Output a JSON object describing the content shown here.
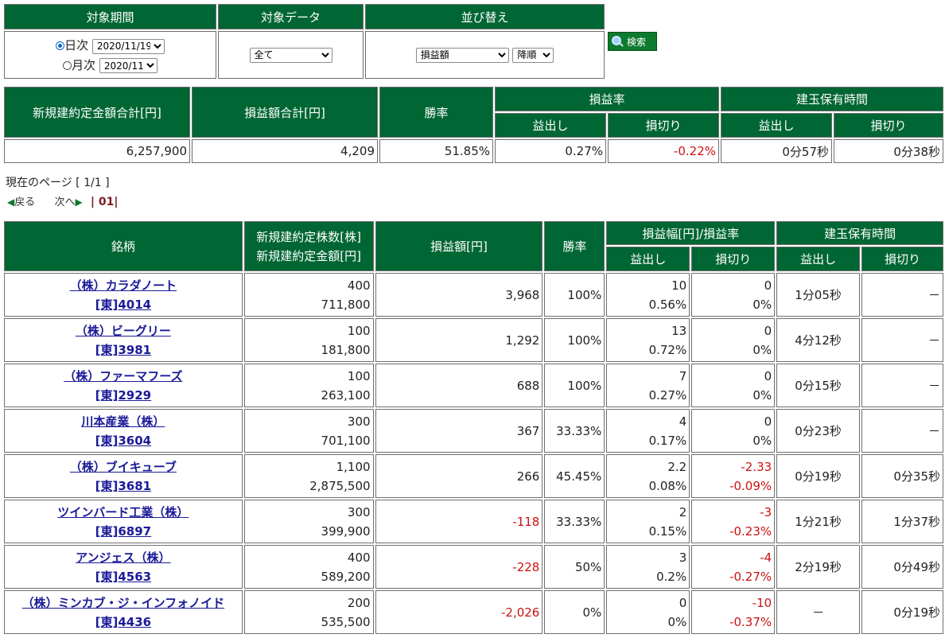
{
  "filters": {
    "period_header": "対象期間",
    "data_header": "対象データ",
    "sort_header": "並び替え",
    "daily_label": "日次",
    "daily_value": "2020/11/19",
    "monthly_label": "月次",
    "monthly_value": "2020/11",
    "data_value": "全て",
    "sort_field_value": "損益額",
    "sort_order_value": "降順",
    "search_label": "検索"
  },
  "summary": {
    "headers": {
      "contract_total": "新規建約定金額合計[円]",
      "pl_total": "損益額合計[円]",
      "win_rate": "勝率",
      "pl_rate": "損益率",
      "hold_time": "建玉保有時間",
      "profit": "益出し",
      "loss": "損切り"
    },
    "values": {
      "contract_total": "6,257,900",
      "pl_total": "4,209",
      "win_rate": "51.85%",
      "profit_rate": "0.27%",
      "loss_rate": "-0.22%",
      "profit_time": "0分57秒",
      "loss_time": "0分38秒"
    }
  },
  "pager": {
    "current_label": "現在のページ [ 1/1 ]",
    "prev_label": "戻る",
    "next_label": "次へ",
    "page_link": "01"
  },
  "detail": {
    "headers": {
      "stock": "銘柄",
      "shares": "新規建約定株数[株]",
      "amount": "新規建約定金額[円]",
      "pl": "損益額[円]",
      "win_rate": "勝率",
      "range": "損益幅[円]/損益率",
      "hold_time": "建玉保有時間",
      "profit": "益出し",
      "loss": "損切り"
    },
    "rows": [
      {
        "name": "（株）カラダノート",
        "code": "[東]4014",
        "shares": "400",
        "amount": "711,800",
        "pl": "3,968",
        "pl_neg": false,
        "win": "100%",
        "p_range": "10",
        "p_rate": "0.56%",
        "l_range": "0",
        "l_rate": "0%",
        "l_neg": false,
        "p_time": "1分05秒",
        "l_time": "－"
      },
      {
        "name": "（株）ビーグリー",
        "code": "[東]3981",
        "shares": "100",
        "amount": "181,800",
        "pl": "1,292",
        "pl_neg": false,
        "win": "100%",
        "p_range": "13",
        "p_rate": "0.72%",
        "l_range": "0",
        "l_rate": "0%",
        "l_neg": false,
        "p_time": "4分12秒",
        "l_time": "－"
      },
      {
        "name": "（株）ファーマフーズ",
        "code": "[東]2929",
        "shares": "100",
        "amount": "263,100",
        "pl": "688",
        "pl_neg": false,
        "win": "100%",
        "p_range": "7",
        "p_rate": "0.27%",
        "l_range": "0",
        "l_rate": "0%",
        "l_neg": false,
        "p_time": "0分15秒",
        "l_time": "－"
      },
      {
        "name": "川本産業（株）",
        "code": "[東]3604",
        "shares": "300",
        "amount": "701,100",
        "pl": "367",
        "pl_neg": false,
        "win": "33.33%",
        "p_range": "4",
        "p_rate": "0.17%",
        "l_range": "0",
        "l_rate": "0%",
        "l_neg": false,
        "p_time": "0分23秒",
        "l_time": "－"
      },
      {
        "name": "（株）ブイキューブ",
        "code": "[東]3681",
        "shares": "1,100",
        "amount": "2,875,500",
        "pl": "266",
        "pl_neg": false,
        "win": "45.45%",
        "p_range": "2.2",
        "p_rate": "0.08%",
        "l_range": "-2.33",
        "l_rate": "-0.09%",
        "l_neg": true,
        "p_time": "0分19秒",
        "l_time": "0分35秒"
      },
      {
        "name": "ツインバード工業（株）",
        "code": "[東]6897",
        "shares": "300",
        "amount": "399,900",
        "pl": "-118",
        "pl_neg": true,
        "win": "33.33%",
        "p_range": "2",
        "p_rate": "0.15%",
        "l_range": "-3",
        "l_rate": "-0.23%",
        "l_neg": true,
        "p_time": "1分21秒",
        "l_time": "1分37秒"
      },
      {
        "name": "アンジェス（株）",
        "code": "[東]4563",
        "shares": "400",
        "amount": "589,200",
        "pl": "-228",
        "pl_neg": true,
        "win": "50%",
        "p_range": "3",
        "p_rate": "0.2%",
        "l_range": "-4",
        "l_rate": "-0.27%",
        "l_neg": true,
        "p_time": "2分19秒",
        "l_time": "0分49秒"
      },
      {
        "name": "（株）ミンカブ・ジ・インフォノイド",
        "code": "[東]4436",
        "shares": "200",
        "amount": "535,500",
        "pl": "-2,026",
        "pl_neg": true,
        "win": "0%",
        "p_range": "0",
        "p_rate": "0%",
        "l_range": "-10",
        "l_rate": "-0.37%",
        "l_neg": true,
        "p_time": "－",
        "l_time": "0分19秒"
      }
    ]
  },
  "colors": {
    "header_green": "#006633",
    "negative_red": "#cc1111",
    "link_blue": "#1a1a99"
  }
}
